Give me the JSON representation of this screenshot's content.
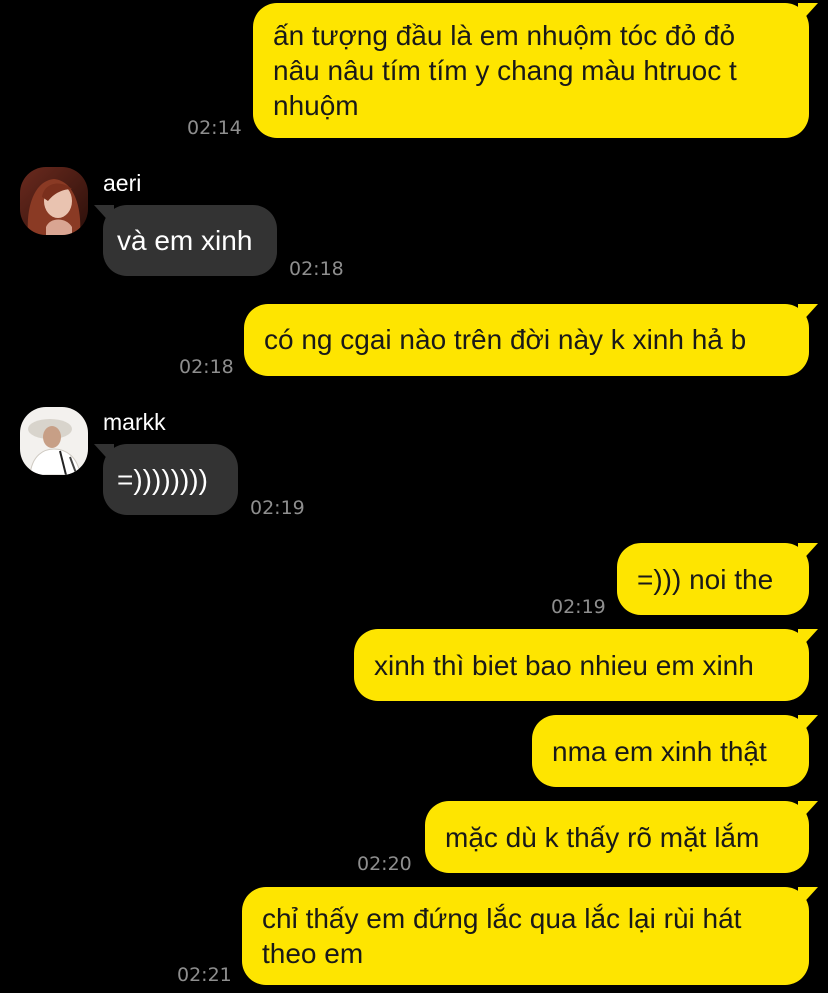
{
  "app": {
    "background": "#000000",
    "outgoing_bubble_color": "#FEE500",
    "incoming_bubble_color": "#333333",
    "timestamp_color": "#8E8E8E"
  },
  "messages": [
    {
      "direction": "out",
      "text": "ấn tượng đầu là em nhuộm tóc đỏ đỏ nâu nâu tím tím y chang màu htruoc t nhuộm",
      "time": "02:14"
    },
    {
      "direction": "in",
      "sender": "aeri",
      "avatar": "aeri-avatar",
      "text": "và em xinh",
      "time": "02:18"
    },
    {
      "direction": "out",
      "text": "có ng cgai nào trên đời này k xinh hả b",
      "time": "02:18"
    },
    {
      "direction": "in",
      "sender": "markk",
      "avatar": "markk-avatar",
      "text": "=))))))))",
      "time": "02:19"
    },
    {
      "direction": "out",
      "text": "=))) noi the",
      "time": "02:19"
    },
    {
      "direction": "out",
      "text": "xinh thì biet bao nhieu em xinh",
      "time": ""
    },
    {
      "direction": "out",
      "text": "nma em xinh thật",
      "time": ""
    },
    {
      "direction": "out",
      "text": "mặc dù k thấy rõ mặt lắm",
      "time": "02:20"
    },
    {
      "direction": "out",
      "text": "chỉ thấy em đứng lắc qua lắc lại rùi hát theo em",
      "time": "02:21"
    }
  ]
}
